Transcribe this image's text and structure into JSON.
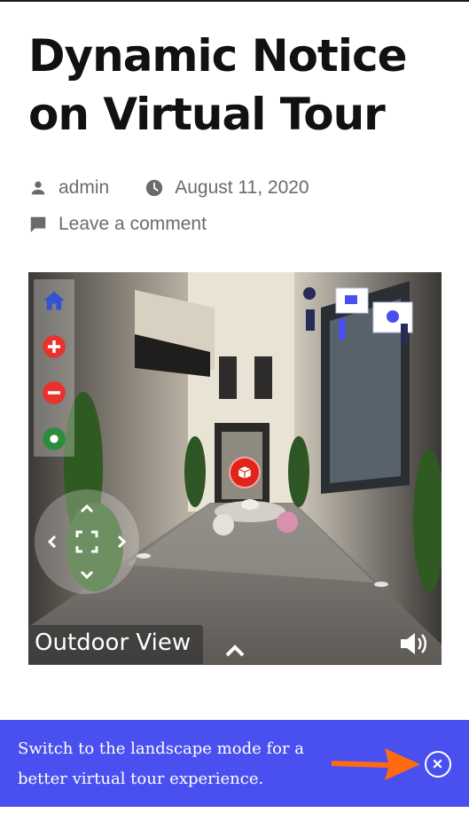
{
  "post": {
    "title": "Dynamic Notice on Virtual Tour",
    "author": "admin",
    "date": "August 11, 2020",
    "comment_link": "Leave a comment"
  },
  "icons": {
    "author": "person-icon",
    "date": "clock-icon",
    "comment": "comment-icon"
  },
  "tour": {
    "scene_label": "Outdoor View",
    "controls": [
      "home-icon",
      "zoom-in-icon",
      "zoom-out-icon",
      "gyro-icon"
    ],
    "nav": [
      "up-arrow-icon",
      "left-arrow-icon",
      "fullscreen-icon",
      "right-arrow-icon",
      "down-arrow-icon"
    ],
    "hotspot_icon": "box-icon",
    "sound_icon": "volume-icon",
    "expand_icon": "chevron-up-icon"
  },
  "notice": {
    "text": "Switch to the landscape mode for a better virtual tour experience.",
    "close_icon": "close-icon",
    "colors": {
      "background": "#4a50f0",
      "arrow": "#ff6a10"
    }
  },
  "colors": {
    "title": "#111111",
    "meta": "#6b6b6b",
    "home": "#3553d1",
    "zoom_in": "#e8322d",
    "zoom_out": "#e8322d",
    "gyro": "#2d8c3c"
  }
}
